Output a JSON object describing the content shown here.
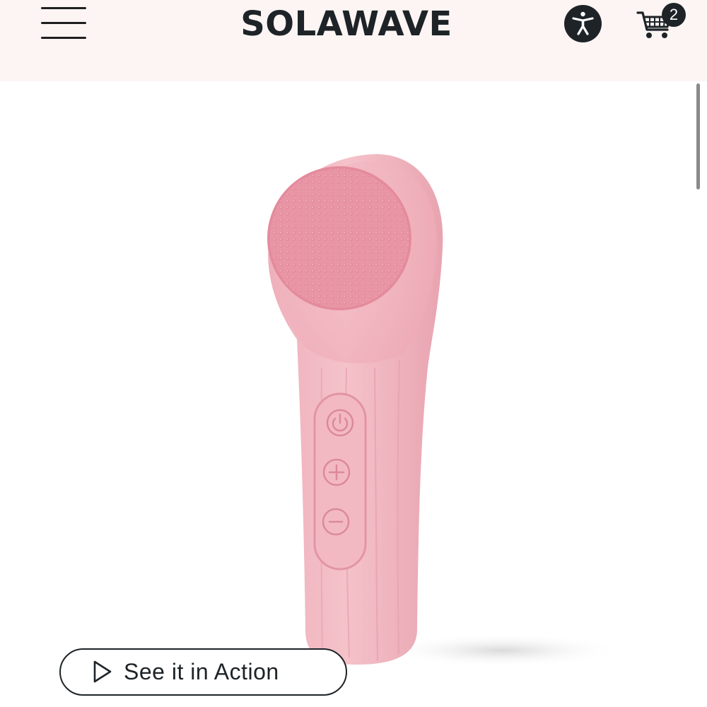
{
  "header": {
    "logo_text": "SOLAWAVE",
    "cart_count": "2",
    "background_color": "#fdf5f4"
  },
  "product": {
    "image_subject": "pink silicone facial cleansing brush",
    "color": "#f2b8c2",
    "buttons": [
      "power-icon",
      "plus-icon",
      "minus-icon"
    ]
  },
  "video_button": {
    "label": "See it in Action",
    "icon": "play-icon"
  },
  "icons": {
    "menu": "hamburger-menu-icon",
    "accessibility": "accessibility-icon",
    "cart": "shopping-cart-icon"
  }
}
